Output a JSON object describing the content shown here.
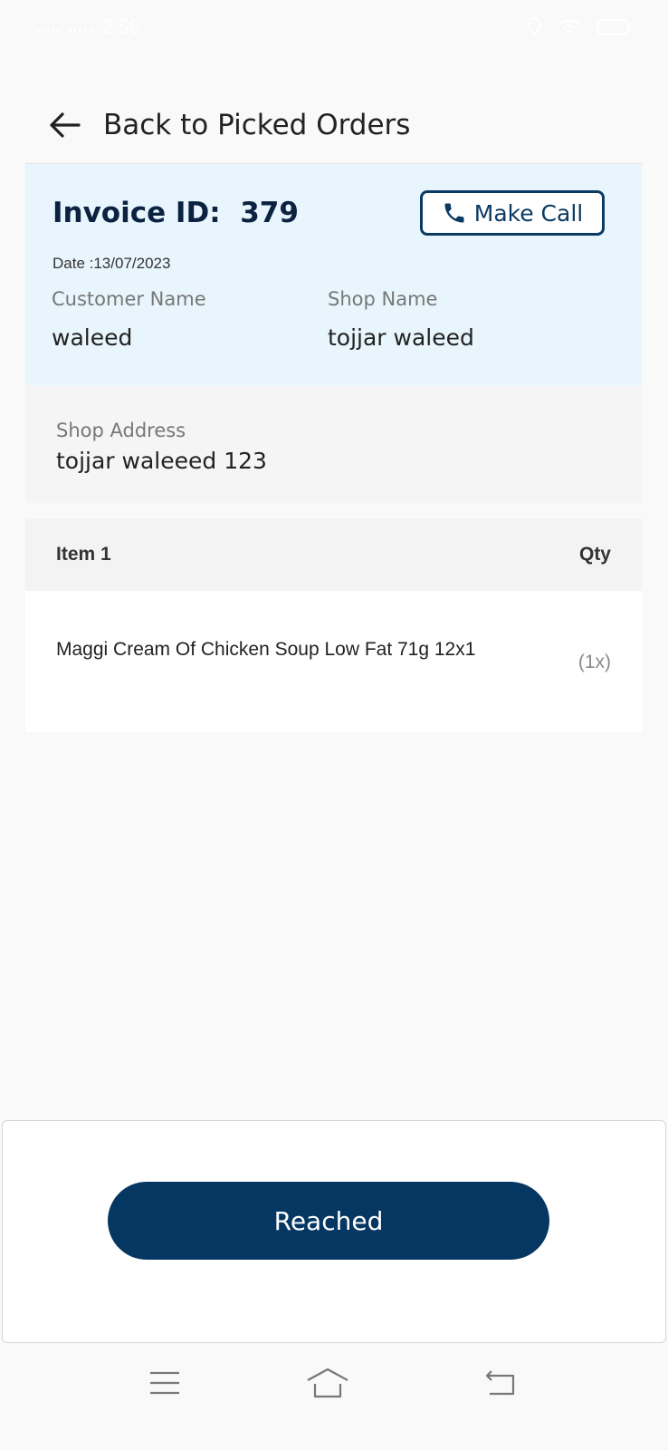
{
  "status_bar": {
    "time": "2:56"
  },
  "header": {
    "title": "Back to Picked Orders"
  },
  "invoice": {
    "id_label": "Invoice ID:",
    "id_value": "379",
    "date": "Date :13/07/2023",
    "call_label": "Make Call",
    "customer_label": "Customer Name",
    "customer_value": "waleed",
    "shop_label": "Shop Name",
    "shop_value": "tojjar waleed"
  },
  "address": {
    "label": "Shop Address",
    "value": "tojjar waleeed 123"
  },
  "items": {
    "col_item": "Item 1",
    "col_qty": "Qty",
    "rows": [
      {
        "name": "Maggi Cream Of Chicken Soup Low Fat 71g 12x1",
        "qty": "(1x)"
      }
    ]
  },
  "action": {
    "label": "Reached"
  },
  "colors": {
    "primary": "#053762",
    "card_bg": "#e8f5fd",
    "accent_border": "#0b3a63"
  },
  "icons": {
    "back": "arrow-left-icon",
    "call": "phone-icon",
    "nav_menu": "menu-icon",
    "nav_home": "home-icon",
    "nav_back": "back-icon",
    "location": "location-icon",
    "wifi": "wifi-icon",
    "battery": "battery-icon"
  }
}
